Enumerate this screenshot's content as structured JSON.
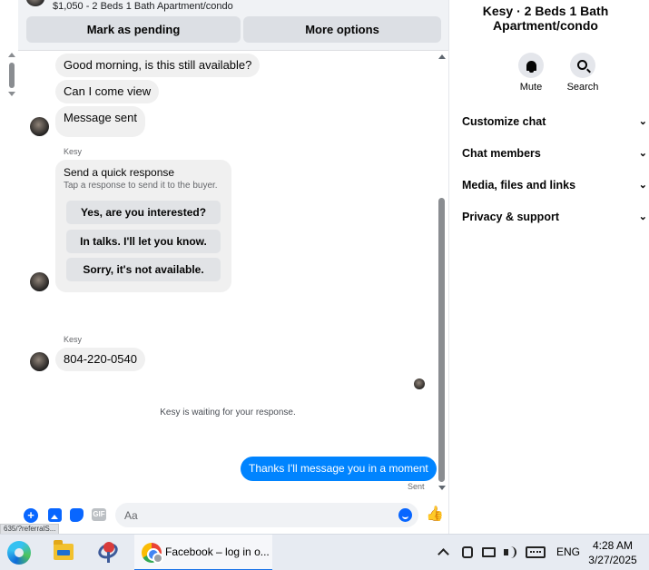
{
  "listing": {
    "price_title": "$1,050 - 2 Beds 1 Bath Apartment/condo",
    "mark_pending_label": "Mark as pending",
    "more_options_label": "More options"
  },
  "messages": {
    "m1": "Good morning, is this still available?",
    "m2": "Can I come view",
    "m3": "Message sent",
    "sender1": "Kesy",
    "quick_title": "Send a quick response",
    "quick_subtitle": "Tap a response to send it to the buyer.",
    "quick_options": [
      "Yes, are you interested?",
      "In talks. I'll let you know.",
      "Sorry, it's not available."
    ],
    "sender2": "Kesy",
    "phone": "804-220-0540",
    "waiting": "Kesy is waiting for your response.",
    "outgoing": "Thanks I'll message you in a moment",
    "sent_status": "Sent"
  },
  "composer": {
    "placeholder": "Aa",
    "gif_label": "GIF",
    "plus_icon": "plus-circle-icon",
    "photo_icon": "photo-icon",
    "sticker_icon": "sticker-icon",
    "emoji_icon": "emoji-icon",
    "like_icon": "thumbs-up-icon"
  },
  "status_url": "635/?referralS...",
  "panel": {
    "title": "Kesy · 2 Beds 1 Bath Apartment/condo",
    "mute_label": "Mute",
    "search_label": "Search",
    "sections": [
      "Customize chat",
      "Chat members",
      "Media, files and links",
      "Privacy & support"
    ]
  },
  "taskbar": {
    "active_window_title": "Facebook – log in o...",
    "language": "ENG",
    "time": "4:28 AM",
    "date": "3/27/2025"
  },
  "colors": {
    "accent": "#0084ff",
    "icon_blue": "#0866ff",
    "bubble_in": "#f0f0f0"
  }
}
